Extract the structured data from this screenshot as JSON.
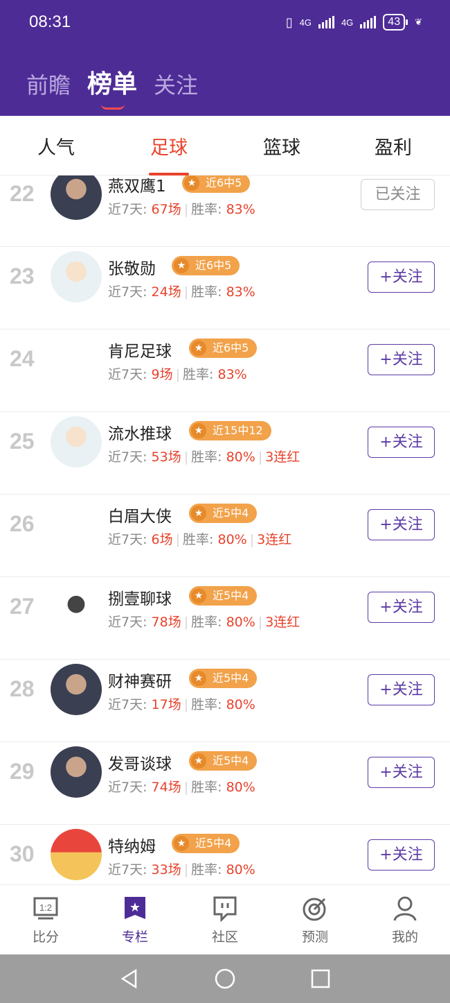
{
  "status": {
    "time": "08:31",
    "net1": "4G",
    "net2": "4G",
    "battery": "43"
  },
  "top_tabs": [
    {
      "label": "前瞻"
    },
    {
      "label": "榜单"
    },
    {
      "label": "关注"
    }
  ],
  "sub_tabs": [
    {
      "label": "人气"
    },
    {
      "label": "足球"
    },
    {
      "label": "篮球"
    },
    {
      "label": "盈利"
    }
  ],
  "stats_labels": {
    "days": "近7天: ",
    "rate": "胜率: "
  },
  "rows": [
    {
      "rank": "22",
      "name": "燕双鹰1",
      "badge": "近6中5",
      "matches": "67场",
      "rate": "83%",
      "streak": "",
      "button": "已关注",
      "followed": true,
      "avatar": "photo-icon"
    },
    {
      "rank": "23",
      "name": "张敬勋",
      "badge": "近6中5",
      "matches": "24场",
      "rate": "83%",
      "streak": "",
      "button": "+关注",
      "followed": false,
      "avatar": "cartoon-icon"
    },
    {
      "rank": "24",
      "name": "肯尼足球",
      "badge": "近6中5",
      "matches": "9场",
      "rate": "83%",
      "streak": "",
      "button": "+关注",
      "followed": false,
      "avatar": ""
    },
    {
      "rank": "25",
      "name": "流水推球",
      "badge": "近15中12",
      "matches": "53场",
      "rate": "80%",
      "streak": "3连红",
      "button": "+关注",
      "followed": false,
      "avatar": "cartoon-icon"
    },
    {
      "rank": "26",
      "name": "白眉大侠",
      "badge": "近5中4",
      "matches": "6场",
      "rate": "80%",
      "streak": "3连红",
      "button": "+关注",
      "followed": false,
      "avatar": ""
    },
    {
      "rank": "27",
      "name": "捌壹聊球",
      "badge": "近5中4",
      "matches": "78场",
      "rate": "80%",
      "streak": "3连红",
      "button": "+关注",
      "followed": false,
      "avatar": "rooster-icon"
    },
    {
      "rank": "28",
      "name": "财神赛研",
      "badge": "近5中4",
      "matches": "17场",
      "rate": "80%",
      "streak": "",
      "button": "+关注",
      "followed": false,
      "avatar": "photo-icon"
    },
    {
      "rank": "29",
      "name": "发哥谈球",
      "badge": "近5中4",
      "matches": "74场",
      "rate": "80%",
      "streak": "",
      "button": "+关注",
      "followed": false,
      "avatar": "photo-icon"
    },
    {
      "rank": "30",
      "name": "特纳姆",
      "badge": "近5中4",
      "matches": "33场",
      "rate": "80%",
      "streak": "",
      "button": "+关注",
      "followed": false,
      "avatar": "flag-icon"
    }
  ],
  "bottom_nav": [
    {
      "label": "比分",
      "icon": "scoreboard-icon"
    },
    {
      "label": "专栏",
      "icon": "star-column-icon"
    },
    {
      "label": "社区",
      "icon": "chat-icon"
    },
    {
      "label": "预测",
      "icon": "target-icon"
    },
    {
      "label": "我的",
      "icon": "person-icon"
    }
  ],
  "colors": {
    "header": "#4e2c96",
    "accent_red": "#e8432d",
    "badge": "#f2a24a",
    "follow_purple": "#5b3aa6"
  }
}
